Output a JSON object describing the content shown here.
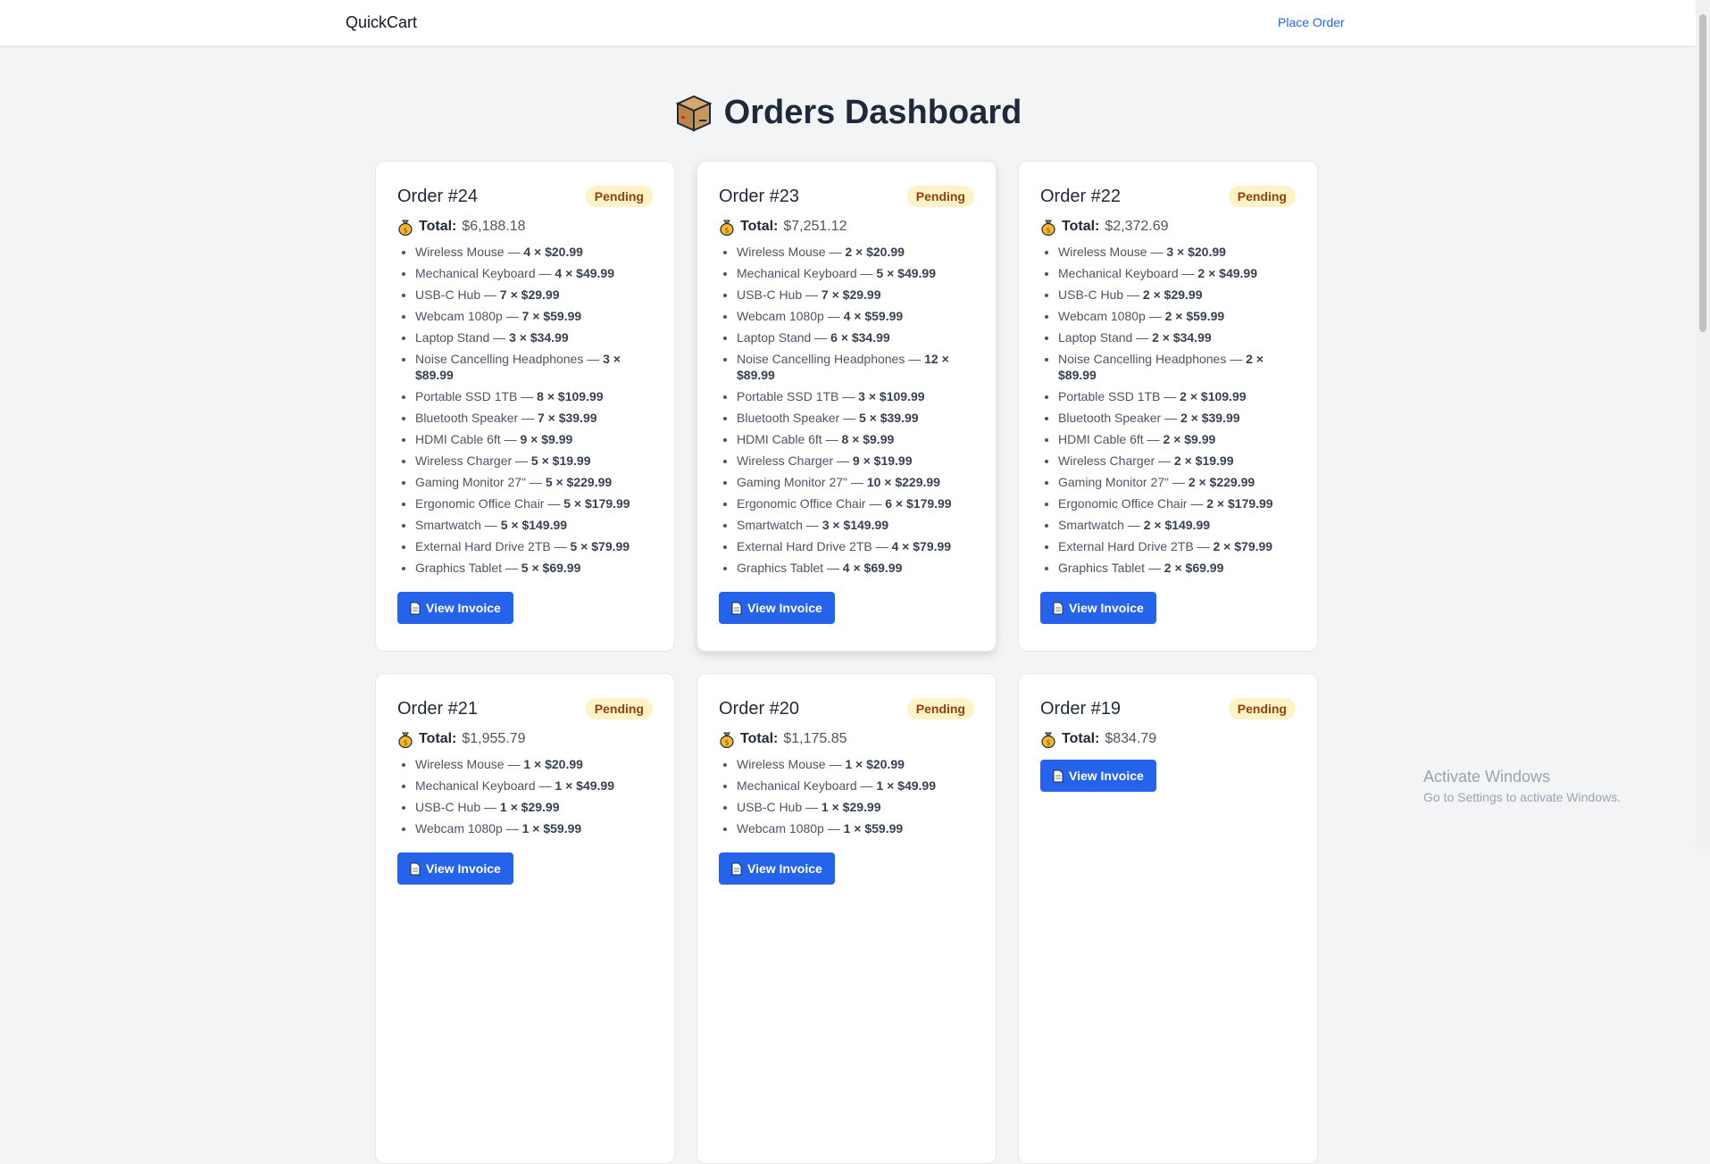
{
  "navbar": {
    "brand": "QuickCart",
    "link": "Place Order"
  },
  "page": {
    "title": "Orders Dashboard",
    "title_icon": "package-icon"
  },
  "labels": {
    "total": "Total:",
    "view_invoice": "View Invoice"
  },
  "colors": {
    "accent": "#2563eb",
    "badge_bg": "#fef3c7",
    "badge_text": "#92400e"
  },
  "orders": [
    {
      "title": "Order #24",
      "status": "Pending",
      "total": "$6,188.18",
      "items": [
        {
          "name": "Wireless Mouse —",
          "qty": "4 × $20.99"
        },
        {
          "name": "Mechanical Keyboard —",
          "qty": "4 × $49.99"
        },
        {
          "name": "USB-C Hub —",
          "qty": "7 × $29.99"
        },
        {
          "name": "Webcam 1080p —",
          "qty": "7 × $59.99"
        },
        {
          "name": "Laptop Stand —",
          "qty": "3 × $34.99"
        },
        {
          "name": "Noise Cancelling Headphones —",
          "qty": "3 × $89.99"
        },
        {
          "name": "Portable SSD 1TB —",
          "qty": "8 × $109.99"
        },
        {
          "name": "Bluetooth Speaker —",
          "qty": "7 × $39.99"
        },
        {
          "name": "HDMI Cable 6ft —",
          "qty": "9 × $9.99"
        },
        {
          "name": "Wireless Charger —",
          "qty": "5 × $19.99"
        },
        {
          "name": "Gaming Monitor 27\" —",
          "qty": "5 × $229.99"
        },
        {
          "name": "Ergonomic Office Chair —",
          "qty": "5 × $179.99"
        },
        {
          "name": "Smartwatch —",
          "qty": "5 × $149.99"
        },
        {
          "name": "External Hard Drive 2TB —",
          "qty": "5 × $79.99"
        },
        {
          "name": "Graphics Tablet —",
          "qty": "5 × $69.99"
        }
      ]
    },
    {
      "title": "Order #23",
      "status": "Pending",
      "total": "$7,251.12",
      "items": [
        {
          "name": "Wireless Mouse —",
          "qty": "2 × $20.99"
        },
        {
          "name": "Mechanical Keyboard —",
          "qty": "5 × $49.99"
        },
        {
          "name": "USB-C Hub —",
          "qty": "7 × $29.99"
        },
        {
          "name": "Webcam 1080p —",
          "qty": "4 × $59.99"
        },
        {
          "name": "Laptop Stand —",
          "qty": "6 × $34.99"
        },
        {
          "name": "Noise Cancelling Headphones —",
          "qty": "12 × $89.99"
        },
        {
          "name": "Portable SSD 1TB —",
          "qty": "3 × $109.99"
        },
        {
          "name": "Bluetooth Speaker —",
          "qty": "5 × $39.99"
        },
        {
          "name": "HDMI Cable 6ft —",
          "qty": "8 × $9.99"
        },
        {
          "name": "Wireless Charger —",
          "qty": "9 × $19.99"
        },
        {
          "name": "Gaming Monitor 27\" —",
          "qty": "10 × $229.99"
        },
        {
          "name": "Ergonomic Office Chair —",
          "qty": "6 × $179.99"
        },
        {
          "name": "Smartwatch —",
          "qty": "3 × $149.99"
        },
        {
          "name": "External Hard Drive 2TB —",
          "qty": "4 × $79.99"
        },
        {
          "name": "Graphics Tablet —",
          "qty": "4 × $69.99"
        }
      ]
    },
    {
      "title": "Order #22",
      "status": "Pending",
      "total": "$2,372.69",
      "items": [
        {
          "name": "Wireless Mouse —",
          "qty": "3 × $20.99"
        },
        {
          "name": "Mechanical Keyboard —",
          "qty": "2 × $49.99"
        },
        {
          "name": "USB-C Hub —",
          "qty": "2 × $29.99"
        },
        {
          "name": "Webcam 1080p —",
          "qty": "2 × $59.99"
        },
        {
          "name": "Laptop Stand —",
          "qty": "2 × $34.99"
        },
        {
          "name": "Noise Cancelling Headphones —",
          "qty": "2 × $89.99"
        },
        {
          "name": "Portable SSD 1TB —",
          "qty": "2 × $109.99"
        },
        {
          "name": "Bluetooth Speaker —",
          "qty": "2 × $39.99"
        },
        {
          "name": "HDMI Cable 6ft —",
          "qty": "2 × $9.99"
        },
        {
          "name": "Wireless Charger —",
          "qty": "2 × $19.99"
        },
        {
          "name": "Gaming Monitor 27\" —",
          "qty": "2 × $229.99"
        },
        {
          "name": "Ergonomic Office Chair —",
          "qty": "2 × $179.99"
        },
        {
          "name": "Smartwatch —",
          "qty": "2 × $149.99"
        },
        {
          "name": "External Hard Drive 2TB —",
          "qty": "2 × $79.99"
        },
        {
          "name": "Graphics Tablet —",
          "qty": "2 × $69.99"
        }
      ]
    },
    {
      "title": "Order #21",
      "status": "Pending",
      "total": "$1,955.79",
      "items": [
        {
          "name": "Wireless Mouse —",
          "qty": "1 × $20.99"
        },
        {
          "name": "Mechanical Keyboard —",
          "qty": "1 × $49.99"
        },
        {
          "name": "USB-C Hub —",
          "qty": "1 × $29.99"
        },
        {
          "name": "Webcam 1080p —",
          "qty": "1 × $59.99"
        }
      ]
    },
    {
      "title": "Order #20",
      "status": "Pending",
      "total": "$1,175.85",
      "items": [
        {
          "name": "Wireless Mouse —",
          "qty": "1 × $20.99"
        },
        {
          "name": "Mechanical Keyboard —",
          "qty": "1 × $49.99"
        },
        {
          "name": "USB-C Hub —",
          "qty": "1 × $29.99"
        },
        {
          "name": "Webcam 1080p —",
          "qty": "1 × $59.99"
        }
      ]
    },
    {
      "title": "Order #19",
      "status": "Pending",
      "total": "$834.79",
      "items": []
    }
  ],
  "watermark": {
    "line1": "Activate Windows",
    "line2": "Go to Settings to activate Windows."
  }
}
